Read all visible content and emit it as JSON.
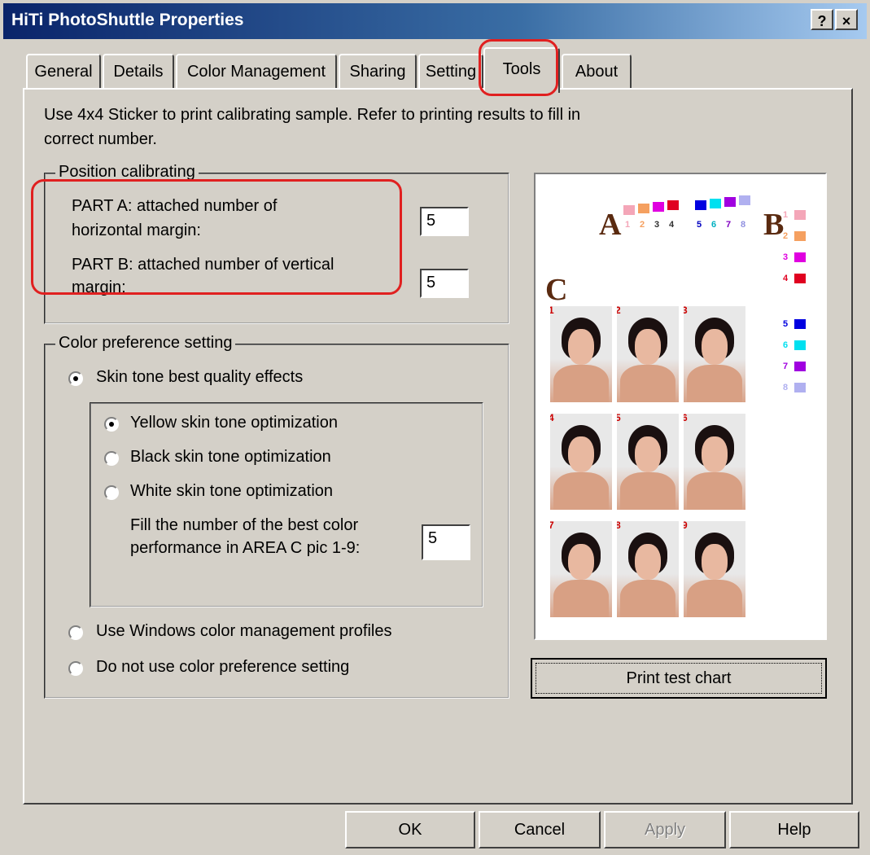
{
  "window": {
    "title": "HiTi PhotoShuttle Properties",
    "help_btn": "?",
    "close_btn": "×"
  },
  "tabs": [
    "General",
    "Details",
    "Color Management",
    "Sharing",
    "Setting",
    "Tools",
    "About"
  ],
  "active_tab": "Tools",
  "instruction": {
    "line1": "Use 4x4 Sticker to print calibrating sample.  Refer to printing results to fill in",
    "line2": "correct number."
  },
  "position": {
    "legend": "Position calibrating",
    "part_a_line1": "PART A: attached number of",
    "part_a_line2": "horizontal margin:",
    "part_a_value": "5",
    "part_b_line1": "PART B: attached number of vertical",
    "part_b_line2": "margin:",
    "part_b_value": "5"
  },
  "color_pref": {
    "legend": "Color preference setting",
    "skin_best": "Skin tone best quality effects",
    "yellow": "Yellow skin tone optimization",
    "black": "Black skin tone optimization",
    "white": "White skin tone optimization",
    "fill_line1": "Fill the number of the best color",
    "fill_line2": "performance in AREA C pic 1-9:",
    "fill_value": "5",
    "windows": "Use Windows color management profiles",
    "none": "Do not use color preference setting"
  },
  "preview": {
    "label_a": "A",
    "label_b": "B",
    "label_c": "C",
    "a_numbers": [
      "1",
      "2",
      "3",
      "4",
      "5",
      "6",
      "7",
      "8"
    ],
    "b_numbers": [
      "1",
      "2",
      "3",
      "4",
      "5",
      "6",
      "7",
      "8"
    ],
    "pic_numbers": [
      "1",
      "2",
      "3",
      "4",
      "5",
      "6",
      "7",
      "8",
      "9"
    ],
    "swatch_colors": [
      "#f4a6b8",
      "#f5a060",
      "#e000e0",
      "#e00020",
      "#0000e0",
      "#00e0f0",
      "#a000e0",
      "#b0b0f0"
    ]
  },
  "buttons": {
    "print_test_chart": "Print test chart",
    "ok": "OK",
    "cancel": "Cancel",
    "apply": "Apply",
    "help": "Help"
  }
}
